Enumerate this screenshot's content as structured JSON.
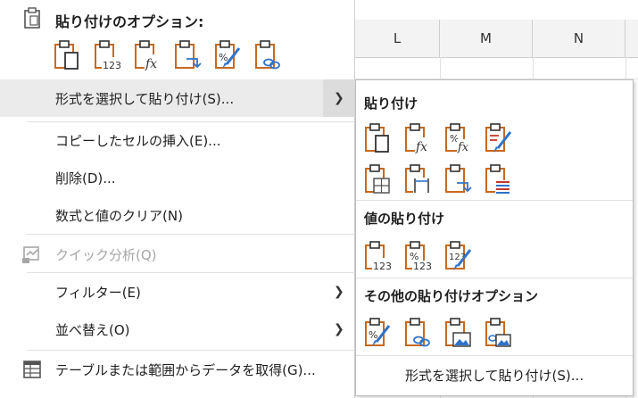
{
  "spreadsheet": {
    "columns": [
      "L",
      "M",
      "N"
    ]
  },
  "menu": {
    "paste_options_title": "貼り付けのオプション:",
    "paste_icons": [
      "paste-icon",
      "paste-values-icon",
      "paste-formulas-icon",
      "paste-transpose-icon",
      "paste-formatting-icon",
      "paste-link-icon"
    ],
    "items": [
      {
        "label": "形式を選択して貼り付け(S)...",
        "has_submenu": true,
        "highlighted": true
      },
      {
        "label": "コピーしたセルの挿入(E)..."
      },
      {
        "label": "削除(D)..."
      },
      {
        "label": "数式と値のクリア(N)"
      },
      {
        "label": "クイック分析(Q)",
        "disabled": true
      },
      {
        "label": "フィルター(E)",
        "has_submenu": true
      },
      {
        "label": "並べ替え(O)",
        "has_submenu": true
      },
      {
        "label": "テーブルまたは範囲からデータを取得(G)..."
      }
    ]
  },
  "submenu": {
    "paste_heading": "貼り付け",
    "values_heading": "値の貼り付け",
    "other_heading": "その他の貼り付けオプション",
    "footer_link": "形式を選択して貼り付け(S)..."
  },
  "colors": {
    "clipboard": "#c8691e",
    "blue": "#2f73c9",
    "red": "#c0392b"
  }
}
